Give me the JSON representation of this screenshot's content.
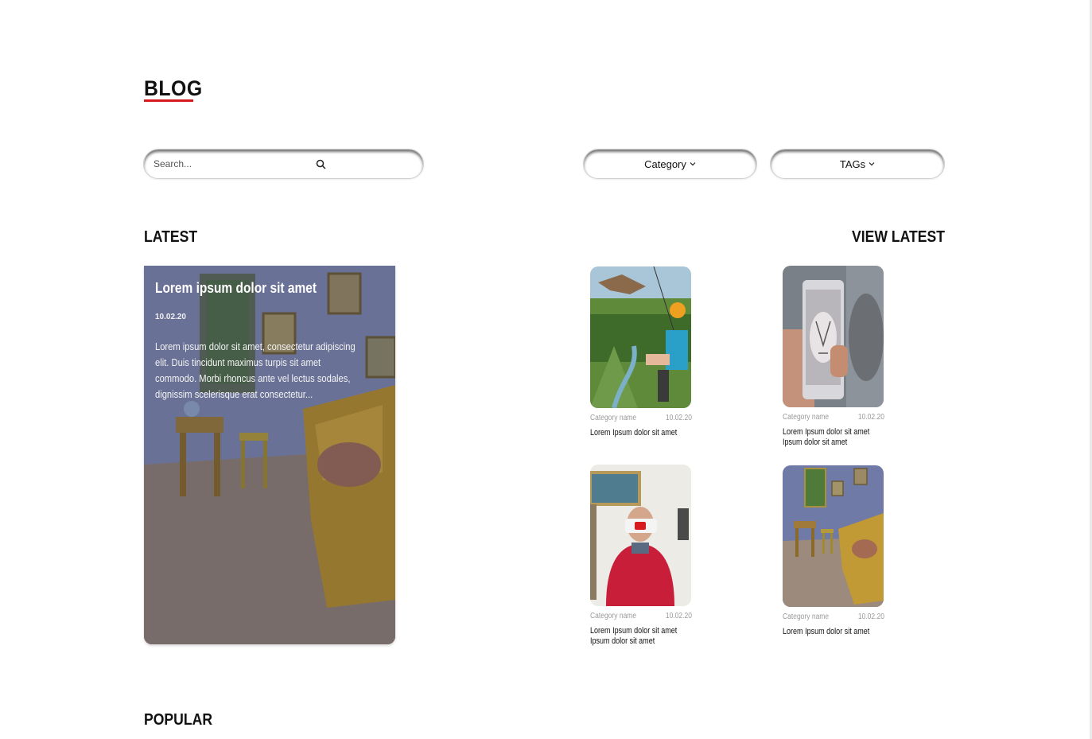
{
  "header": {
    "title": "BLOG",
    "accent_color": "#d71920"
  },
  "search": {
    "placeholder": "Search..."
  },
  "filters": {
    "category_label": "Category",
    "tags_label": "TAGs"
  },
  "latest": {
    "title": "LATEST",
    "view_label": "VIEW LATEST",
    "featured": {
      "title": "Lorem ipsum dolor sit amet",
      "date": "10.02.20",
      "excerpt": "Lorem ipsum dolor sit amet, consectetur adipiscing elit. Duis tincidunt maximus turpis sit amet commodo. Morbi rhoncus ante vel lectus sodales, dignissim scelerisque erat consectetur..."
    },
    "cards": [
      {
        "category": "Category name",
        "date": "10.02.20",
        "title": "Lorem Ipsum dolor sit amet"
      },
      {
        "category": "Category name",
        "date": "10.02.20",
        "title": "Lorem Ipsum dolor sit amet Ipsum dolor sit amet"
      },
      {
        "category": "Category name",
        "date": "10.02.20",
        "title": "Lorem Ipsum dolor sit amet Ipsum dolor sit amet"
      },
      {
        "category": "Category name",
        "date": "10.02.20",
        "title": "Lorem Ipsum dolor sit amet"
      }
    ]
  },
  "popular": {
    "title": "POPULAR"
  }
}
